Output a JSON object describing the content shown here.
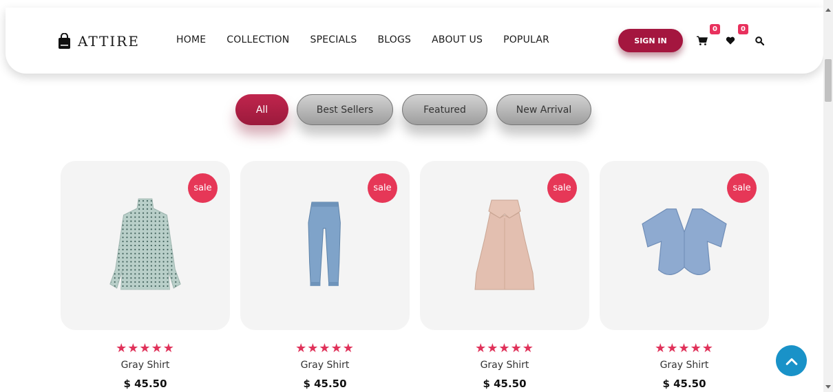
{
  "header": {
    "logo_text": "ATTIRE",
    "nav": [
      "HOME",
      "COLLECTION",
      "SPECIALS",
      "BLOGS",
      "ABOUT US",
      "POPULAR"
    ],
    "signin_label": "SIGN IN",
    "cart_count": "0",
    "wishlist_count": "0",
    "icons": [
      "bag-logo-icon",
      "cart-icon",
      "heart-icon",
      "search-icon"
    ]
  },
  "filters": {
    "items": [
      "All",
      "Best Sellers",
      "Featured",
      "New Arrival"
    ],
    "active": "All"
  },
  "products": [
    {
      "badge": "sale",
      "stars": "★★★★★",
      "rating": 5,
      "name": "Gray Shirt",
      "price": "$ 45.50",
      "image": "dotted-blouse"
    },
    {
      "badge": "sale",
      "stars": "★★★★★",
      "rating": 5,
      "name": "Gray Shirt",
      "price": "$ 45.50",
      "image": "jeans"
    },
    {
      "badge": "sale",
      "stars": "★★★★★",
      "rating": 5,
      "name": "Gray Shirt",
      "price": "$ 45.50",
      "image": "halter-top"
    },
    {
      "badge": "sale",
      "stars": "★★★★★",
      "rating": 5,
      "name": "Gray Shirt",
      "price": "$ 45.50",
      "image": "crop-tee"
    }
  ],
  "colors": {
    "brand": "#a4163f",
    "sale_badge": "#e63757",
    "stars": "#e0325a",
    "back_to_top": "#1992c8"
  },
  "back_to_top_icon": "chevron-up-icon"
}
